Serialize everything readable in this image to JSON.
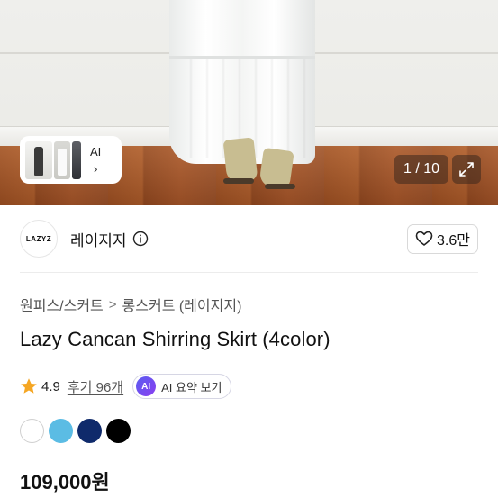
{
  "gallery": {
    "ai_chip_label": "AI",
    "ai_chip_chevron": "›",
    "counter": "1 / 10",
    "expand_icon": "expand-icon"
  },
  "store": {
    "logo_text": "LAZYZ",
    "name": "레이지지",
    "info_icon": "info-icon",
    "like_count": "3.6만",
    "like_icon": "heart-outline-icon"
  },
  "breadcrumb": {
    "items": [
      "원피스/스커트",
      "롱스커트 (레이지지)"
    ],
    "separator": ">"
  },
  "product": {
    "title": "Lazy Cancan Shirring Skirt (4color)",
    "rating": "4.9",
    "reviews": "후기 96개",
    "ai_summary_badge": "AI",
    "ai_summary_label": "AI 요약 보기",
    "price": "109,000원"
  },
  "colors": [
    {
      "name": "white",
      "hex": "#ffffff"
    },
    {
      "name": "sky-blue",
      "hex": "#5bbce4"
    },
    {
      "name": "navy",
      "hex": "#0f2a6b"
    },
    {
      "name": "black",
      "hex": "#000000"
    }
  ],
  "accent": {
    "star": "#f5a623",
    "ai_gradient_start": "#5a5cf0",
    "ai_gradient_end": "#8a3ff0"
  }
}
